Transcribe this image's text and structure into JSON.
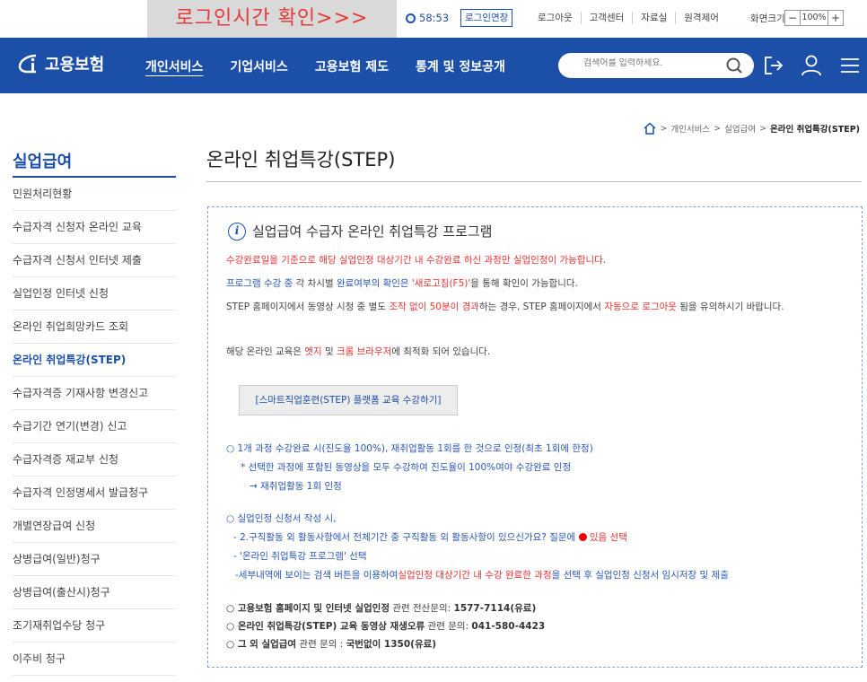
{
  "util": {
    "login_notice": "로그인시간 확인>>>",
    "timer": "58:53",
    "extend": "로그인연장",
    "links": [
      "로그아웃",
      "고객센터",
      "자료실",
      "원격제어"
    ],
    "zoom_label": "화면크기",
    "zoom_minus": "−",
    "zoom_value": "100%",
    "zoom_plus": "+"
  },
  "nav": {
    "logo": "고용보험",
    "menu": [
      "개인서비스",
      "기업서비스",
      "고용보험 제도",
      "통계 및 정보공개"
    ],
    "search_placeholder": "검색어를 입력하세요."
  },
  "breadcrumb": [
    "개인서비스",
    "실업급여",
    "온라인 취업특강(STEP)"
  ],
  "sidebar": {
    "title": "실업급여",
    "items": [
      "민원처리현황",
      "수급자격 신청자 온라인 교육",
      "수급자격 신청서 인터넷 제출",
      "실업인정 인터넷 신청",
      "온라인 취업희망카드 조회",
      "온라인 취업특강(STEP)",
      "수급자격증 기재사항 변경신고",
      "수급기간 연기(변경) 신고",
      "수급자격증 재교부 신청",
      "수급자격 인정명세서 발급청구",
      "개별연장급여 신청",
      "상병급여(일반)청구",
      "상병급여(출산시)청구",
      "조기재취업수당 청구",
      "이주비 청구"
    ]
  },
  "main": {
    "title": "온라인 취업특강(STEP)",
    "box_title": "실업급여 수급자 온라인 취업특강 프로그램",
    "p1": "수강완료일을 기준으로 해당 실업인정 대상기간 내 수강완료 하신 과정만 실업인정이 가능합니다.",
    "p2a": "프로그램 수강 중",
    "p2b": " 각 차시별 ",
    "p2c": "완료여부의 확인은",
    "p2d": " '새로고침(F5)'",
    "p2e": "을 통해 확인이 가능합니다.",
    "p3a": "STEP 홈페이지에서 동영상 시청 중 별도 ",
    "p3b": "조작 없이 50분이 경과",
    "p3c": "하는 경우, STEP 홈페이지에서 ",
    "p3d": "자동으로 로그아웃",
    "p3e": " 됨을 유의하시기 바랍니다.",
    "p4a": "해당 온라인 교육은 ",
    "p4b": "엣지",
    "p4c": " 및 ",
    "p4d": "크롬 브라우저",
    "p4e": "에 최적화 되어 있습니다.",
    "step_button": "[스마트직업훈련(STEP) 플랫폼 교육 수강하기]",
    "b1": "○ 1개 과정 수강완료 시(진도율 100%), 재취업활동 1회를 한 것으로 인정(최초 1회에 한정)",
    "b2": "* 선택한 과정에 포함된 동영상을 모두 수강하여 진도율이 100%여야 수강완료 인정",
    "b3": "→ 재취업활동 1회 인정",
    "c1": "○ 실업인정 신청서 작성 시,",
    "c2a": "- 2.구직활동 외 활동사항에서 전체기간 중 구직활동 외 활동사항이 있으신가요? 질문에 ",
    "c2b": "있음 선택",
    "c3a": "- '",
    "c3b": "온라인 취업특강 프로그램",
    "c3c": "' 선택",
    "c4a": "-세부내역에 보이는 검색 버튼을 이용하여",
    "c4b": "실업인정 대상기간 내 수강 완료한 과정",
    "c4c": "을 선택 후 실업인정 신청서 임시저장 및 제출",
    "d1a": "○ 고용보험 홈페이지 및 인터넷 실업인정",
    "d1b": " 관련 전산문의: ",
    "d1c": "1577-7114(유료)",
    "d2a": "○ 온라인 취업특강(STEP) 교육 동영상 재생오류",
    "d2b": " 관련 문의: ",
    "d2c": "041-580-4423",
    "d3a": "○ 그 외 ",
    "d3b": "실업급여",
    "d3c": " 관련 문의 : ",
    "d3d": "국번없이 1350(유료)"
  },
  "colors": {
    "primary": "#1b4fa8",
    "red": "#e33333",
    "notice_bg": "#d9d9d9"
  }
}
